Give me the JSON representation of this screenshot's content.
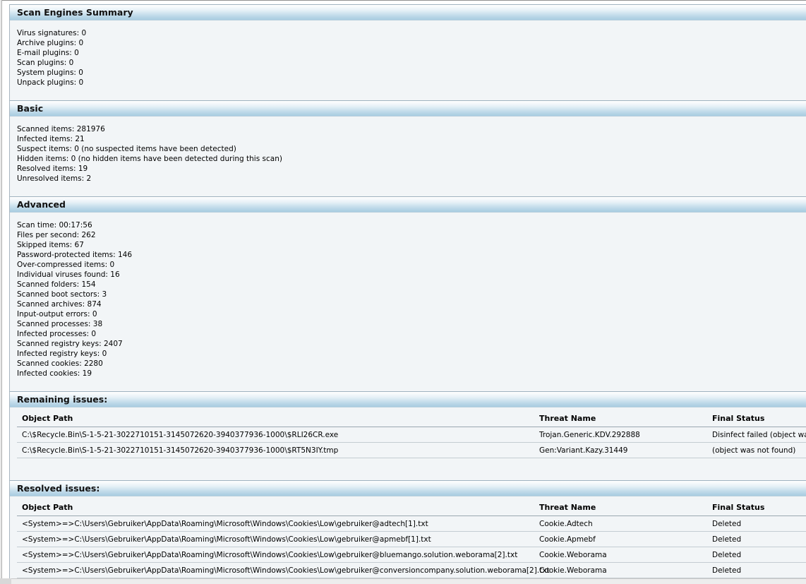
{
  "scan_engines": {
    "title": "Scan Engines Summary",
    "items": [
      "Virus signatures: 0",
      "Archive plugins: 0",
      "E-mail plugins: 0",
      "Scan plugins: 0",
      "System plugins: 0",
      "Unpack plugins: 0"
    ]
  },
  "basic": {
    "title": "Basic",
    "items": [
      "Scanned items: 281976",
      "Infected items: 21",
      "Suspect items: 0 (no suspected items have been detected)",
      "Hidden items: 0 (no hidden items have been detected during this scan)",
      "Resolved items: 19",
      "Unresolved items: 2"
    ]
  },
  "advanced": {
    "title": "Advanced",
    "items": [
      "Scan time: 00:17:56",
      "Files per second: 262",
      "Skipped items: 67",
      "Password-protected items: 146",
      "Over-compressed items: 0",
      "Individual viruses found: 16",
      "Scanned folders: 154",
      "Scanned boot sectors: 3",
      "Scanned archives: 874",
      "Input-output errors: 0",
      "Scanned processes: 38",
      "Infected processes: 0",
      "Scanned registry keys: 2407",
      "Infected registry keys: 0",
      "Scanned cookies: 2280",
      "Infected cookies: 19"
    ]
  },
  "remaining": {
    "title": "Remaining issues:",
    "columns": [
      "Object Path",
      "Threat Name",
      "Final Status"
    ],
    "rows": [
      {
        "path": "C:\\$Recycle.Bin\\S-1-5-21-3022710151-3145072620-3940377936-1000\\$RLI26CR.exe",
        "threat": "Trojan.Generic.KDV.292888",
        "status": "Disinfect failed (object was not found)"
      },
      {
        "path": "C:\\$Recycle.Bin\\S-1-5-21-3022710151-3145072620-3940377936-1000\\$RT5N3IY.tmp",
        "threat": "Gen:Variant.Kazy.31449",
        "status": "(object was not found)"
      }
    ]
  },
  "resolved": {
    "title": "Resolved issues:",
    "columns": [
      "Object Path",
      "Threat Name",
      "Final Status"
    ],
    "rows": [
      {
        "path": "<System>=>C:\\Users\\Gebruiker\\AppData\\Roaming\\Microsoft\\Windows\\Cookies\\Low\\gebruiker@adtech[1].txt",
        "threat": "Cookie.Adtech",
        "status": "Deleted"
      },
      {
        "path": "<System>=>C:\\Users\\Gebruiker\\AppData\\Roaming\\Microsoft\\Windows\\Cookies\\Low\\gebruiker@apmebf[1].txt",
        "threat": "Cookie.Apmebf",
        "status": "Deleted"
      },
      {
        "path": "<System>=>C:\\Users\\Gebruiker\\AppData\\Roaming\\Microsoft\\Windows\\Cookies\\Low\\gebruiker@bluemango.solution.weborama[2].txt",
        "threat": "Cookie.Weborama",
        "status": "Deleted"
      },
      {
        "path": "<System>=>C:\\Users\\Gebruiker\\AppData\\Roaming\\Microsoft\\Windows\\Cookies\\Low\\gebruiker@conversioncompany.solution.weborama[2].txt",
        "threat": "Cookie.Weborama",
        "status": "Deleted"
      }
    ]
  }
}
